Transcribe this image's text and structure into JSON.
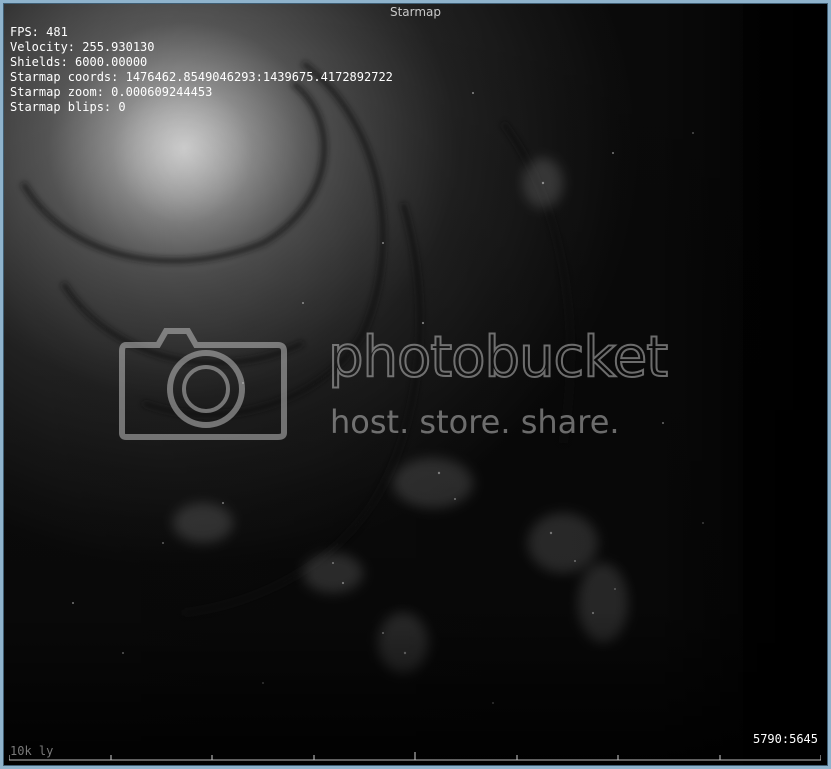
{
  "window": {
    "title": "Starmap"
  },
  "hud": {
    "fps": "FPS: 481",
    "velocity": "Velocity: 255.930130",
    "shields": "Shields: 6000.00000",
    "starmap_coords": "Starmap coords: 1476462.8549046293:1439675.4172892722",
    "starmap_zoom": "Starmap zoom: 0.000609244453",
    "starmap_blips": "Starmap blips: 0"
  },
  "scale": {
    "label": "10k ly"
  },
  "cursor_readout": "5790:5645",
  "watermark": {
    "brand": "photobucket",
    "tagline": "host. store. share."
  },
  "colors": {
    "frame": "#8fb3cc",
    "hud_text": "#ffffff",
    "scale_label": "#7a7a7a"
  }
}
